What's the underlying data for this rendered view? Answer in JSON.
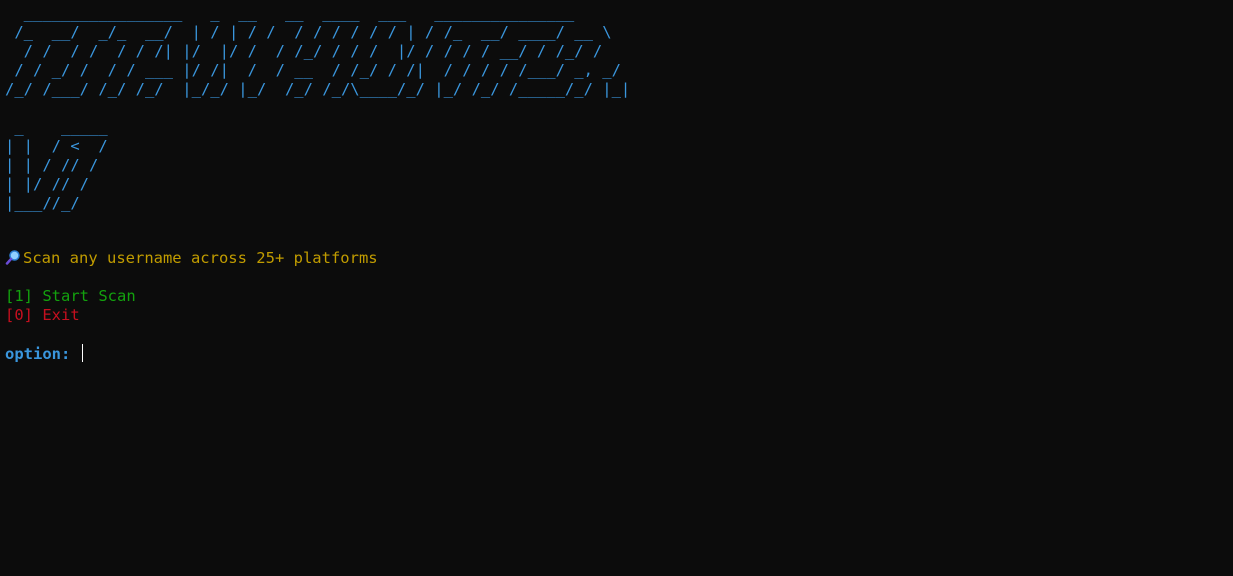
{
  "banner": {
    "lines": [
      "  _________________   _  __   __  ____  ___   _______________",
      " /_  __/  _/_  __/  | / | / /  / / / / / / | / /_  __/ ____/ __ \\",
      "  / /  / /  / / /| |/  |/ /  / /_/ / / /  |/ / / / / __/ / /_/ /",
      " / / _/ /  / / ___ |/ /|  /  / __  / /_/ / /|  / / / / /___/ _, _/",
      "/_/ /___/ /_/ /_/  |_/_/ |_/  /_/ /_/\\____/_/ |_/ /_/ /_____/_/ |_|"
    ]
  },
  "logo": {
    "lines": [
      " _    _____",
      "| |  / <  /",
      "| | / // /",
      "| |/ // /",
      "|___//_/"
    ]
  },
  "tagline": {
    "icon": "magnifier-icon",
    "text": "Scan any username across 25+ platforms"
  },
  "menu": {
    "start_label": "[1] Start Scan",
    "exit_label": "[0] Exit"
  },
  "prompt": {
    "label": "option:",
    "value": ""
  },
  "colors": {
    "background": "#0c0c0c",
    "banner": "#3a96dd",
    "tagline": "#c19c00",
    "start": "#13a10e",
    "exit": "#c50f1f",
    "prompt": "#3a96dd"
  }
}
